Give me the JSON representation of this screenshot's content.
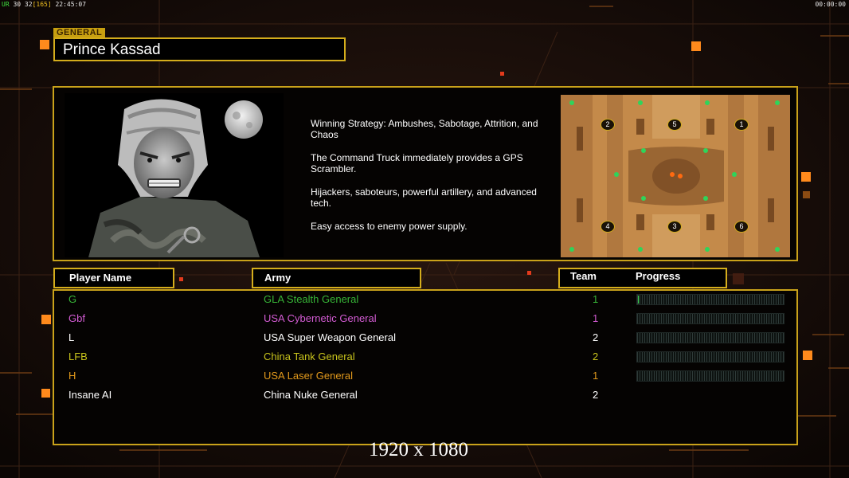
{
  "hud": {
    "ur_label": "UR",
    "stats": "30 32",
    "bracket": "[165]",
    "clock": "22:45:07",
    "timer": "00:00:00"
  },
  "general": {
    "section_label": "GENERAL",
    "name": "Prince Kassad"
  },
  "description": [
    "Winning Strategy: Ambushes, Sabotage, Attrition, and Chaos",
    "The Command Truck immediately provides a GPS Scrambler.",
    "Hijackers, saboteurs, powerful artillery, and advanced tech.",
    "Easy access to enemy power supply."
  ],
  "minimap": {
    "start_positions": [
      "2",
      "5",
      "1",
      "4",
      "3",
      "6"
    ]
  },
  "table_headers": {
    "player": "Player Name",
    "army": "Army",
    "team": "Team",
    "progress": "Progress"
  },
  "players": [
    {
      "name": "G",
      "army": "GLA Stealth General",
      "team": "1",
      "color": "#37b537",
      "progress": 0.01
    },
    {
      "name": "Gbf",
      "army": "USA Cybernetic General",
      "team": "1",
      "color": "#d45cd4",
      "progress": 0
    },
    {
      "name": "L",
      "army": "USA Super Weapon General",
      "team": "2",
      "color": "#ffffff",
      "progress": 0
    },
    {
      "name": "LFB",
      "army": "China Tank General",
      "team": "2",
      "color": "#c9c41c",
      "progress": 0
    },
    {
      "name": "H",
      "army": "USA Laser General",
      "team": "1",
      "color": "#e39a1c",
      "progress": 0
    },
    {
      "name": "Insane AI",
      "army": "China Nuke General",
      "team": "2",
      "color": "#ffffff",
      "progress": null
    }
  ],
  "resolution_label": "1920 x 1080",
  "colors": {
    "accent_gold": "#d4ad1c",
    "accent_orange": "#ff8a1c",
    "background": "#150d0a"
  }
}
